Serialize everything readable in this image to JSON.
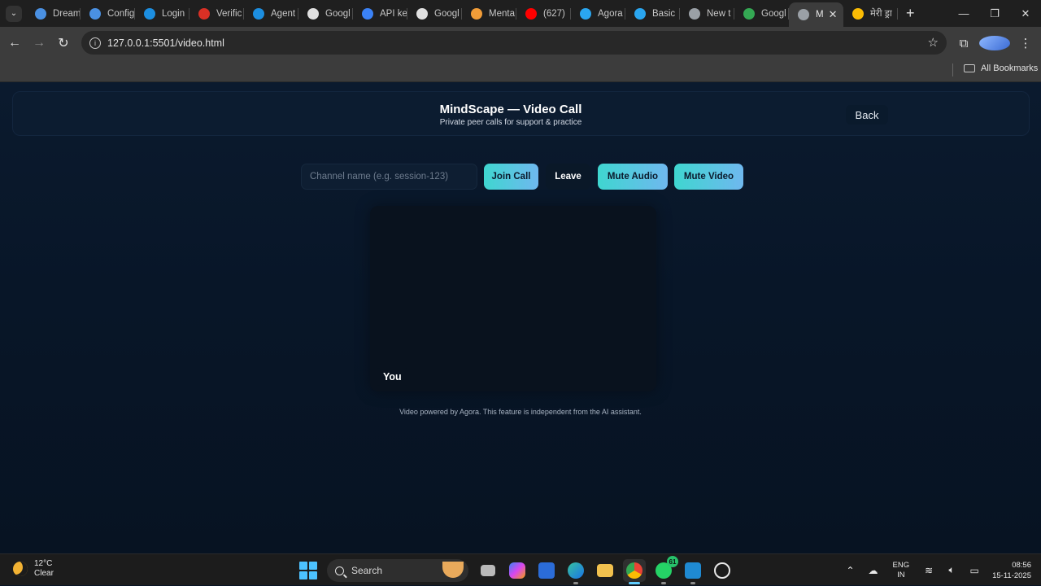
{
  "browser": {
    "tabs": [
      {
        "label": "Dream",
        "color": "#4a90e2"
      },
      {
        "label": "Config",
        "color": "#4a90e2"
      },
      {
        "label": "Login",
        "color": "#1c8ee0"
      },
      {
        "label": "Verific",
        "color": "#d93025"
      },
      {
        "label": "Agent",
        "color": "#1c8ee0"
      },
      {
        "label": "Googl",
        "color": "#e0e0e0"
      },
      {
        "label": "API ke",
        "color": "#3b82f6"
      },
      {
        "label": "Googl",
        "color": "#e0e0e0"
      },
      {
        "label": "Menta",
        "color": "#f29d38"
      },
      {
        "label": "(627)",
        "color": "#ff0000"
      },
      {
        "label": "Agora",
        "color": "#2aa6f0"
      },
      {
        "label": "Basic",
        "color": "#2aa6f0"
      },
      {
        "label": "New t",
        "color": "#9aa0a6"
      },
      {
        "label": "Googl",
        "color": "#34a853"
      },
      {
        "label": "M",
        "color": "#9aa0a6"
      },
      {
        "label": "मेरी ड्रा",
        "color": "#fbbc04"
      }
    ],
    "active_tab_index": 14,
    "url": "127.0.0.1:5501/video.html",
    "bookmarks_label": "All Bookmarks"
  },
  "page": {
    "title": "MindScape — Video Call",
    "subtitle": "Private peer calls for support & practice",
    "back_label": "Back",
    "channel_placeholder": "Channel name (e.g. session-123)",
    "buttons": {
      "join": "Join Call",
      "leave": "Leave",
      "mute_audio": "Mute Audio",
      "mute_video": "Mute Video"
    },
    "local_video_label": "You",
    "footnote": "Video powered by Agora. This feature is independent from the AI assistant."
  },
  "taskbar": {
    "weather": {
      "temp": "12°C",
      "condition": "Clear"
    },
    "search_label": "Search",
    "whatsapp_badge": "61",
    "language": {
      "line1": "ENG",
      "line2": "IN"
    },
    "time": "08:56",
    "date": "15-11-2025"
  }
}
